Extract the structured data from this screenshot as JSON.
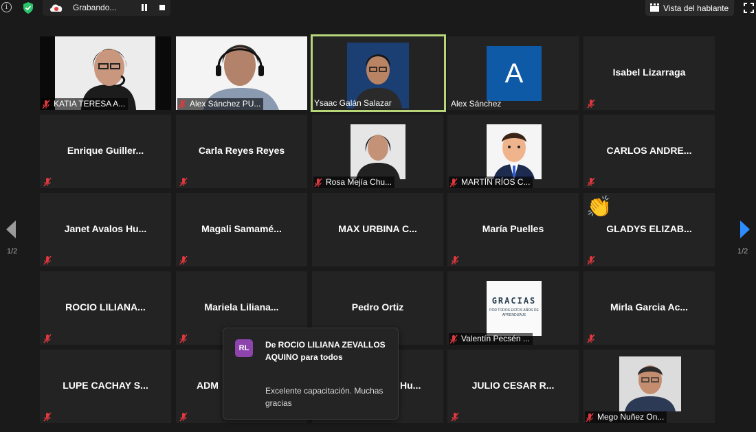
{
  "topbar": {
    "recording_label": "Grabando...",
    "speaker_view_label": "Vista del hablante"
  },
  "pagination": {
    "left": "1/2",
    "right": "1/2"
  },
  "participants": [
    {
      "name": "KATIA TERESA A...",
      "video": "woman-headset",
      "muted": true
    },
    {
      "name": "Alex Sánchez PU...",
      "video": "man-headset",
      "muted": true
    },
    {
      "name": "Ysaac Galán Salazar",
      "video": "man-glasses",
      "muted": false,
      "active": true
    },
    {
      "name": "Alex Sánchez",
      "video": "avatar-A",
      "avatar_letter": "A",
      "muted": false
    },
    {
      "name": "Isabel Lizarraga",
      "video": "none",
      "muted": true
    },
    {
      "name": "Enrique  Guiller...",
      "video": "none",
      "muted": true
    },
    {
      "name": "Carla Reyes Reyes",
      "video": "none",
      "muted": true
    },
    {
      "name": "Rosa Mejía Chu...",
      "video": "woman-portrait",
      "muted": true
    },
    {
      "name": "MARTÍN RÍOS C...",
      "video": "cartoon-man",
      "muted": true
    },
    {
      "name": "CARLOS ANDRE...",
      "video": "none",
      "muted": true
    },
    {
      "name": "Janet Avalos Hu...",
      "video": "none",
      "muted": true
    },
    {
      "name": "Magali  Samamé...",
      "video": "none",
      "muted": true
    },
    {
      "name": "MAX URBINA C...",
      "video": "none",
      "muted": false
    },
    {
      "name": "María Puelles",
      "video": "none",
      "muted": true
    },
    {
      "name": "GLADYS ELIZAB...",
      "video": "none",
      "muted": true,
      "reaction": "👏"
    },
    {
      "name": "ROCIO LILIANA...",
      "video": "none",
      "muted": true
    },
    {
      "name": "Mariela  Liliana...",
      "video": "none",
      "muted": true
    },
    {
      "name": "Pedro Ortiz",
      "video": "none",
      "muted": false
    },
    {
      "name": "Valentín Pecsén ...",
      "video": "gracias-card",
      "muted": true
    },
    {
      "name": "Mirla Garcia Ac...",
      "video": "none",
      "muted": true
    },
    {
      "name": "LUPE CACHAY S...",
      "video": "none",
      "muted": true
    },
    {
      "name": "ADM",
      "video": "none",
      "muted": true
    },
    {
      "name": "Hu...",
      "video": "none",
      "muted": true
    },
    {
      "name": "JULIO CESAR R...",
      "video": "none",
      "muted": true
    },
    {
      "name": "Mego Nuñez On...",
      "video": "older-man",
      "muted": true
    }
  ],
  "gracias_card": {
    "title": "GRACIAS",
    "subtitle": "POR TODOS ESTOS AÑOS DE APRENDIZAJE"
  },
  "chat_toast": {
    "avatar_initials": "RL",
    "sender": "De ROCIO LILIANA ZEVALLOS AQUINO para todos",
    "message": "Excelente capacitación. Muchas gracias"
  },
  "colors": {
    "active_speaker": "#b7d67a",
    "muted_icon": "#e0383e",
    "nav_arrow_right": "#2d8cff"
  }
}
